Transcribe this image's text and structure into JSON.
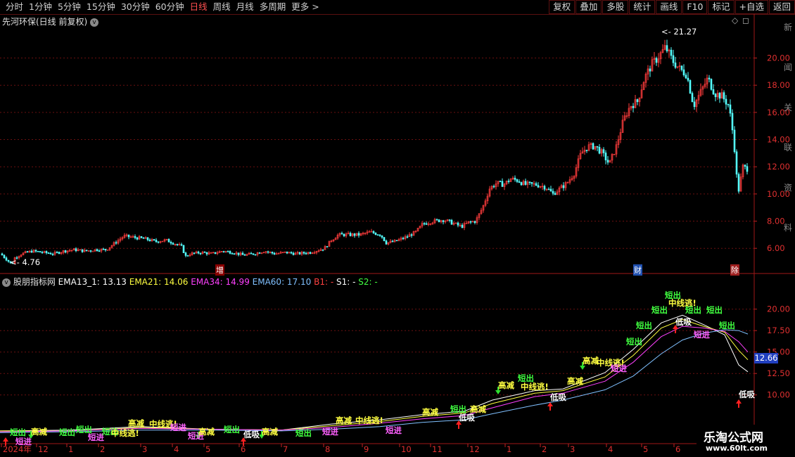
{
  "toolbar": {
    "periods": [
      "分时",
      "1分钟",
      "5分钟",
      "15分钟",
      "30分钟",
      "60分钟",
      "日线",
      "周线",
      "月线",
      "多周期",
      "更多"
    ],
    "active_period": "日线",
    "tools": [
      "复权",
      "叠加",
      "多股",
      "统计",
      "画线",
      "F10",
      "标记",
      "+自选",
      "返回"
    ]
  },
  "main_panel": {
    "title": "先河环保(日线 前复权)",
    "high_label": "21.27",
    "low_label": "4.76",
    "markers": [
      "增",
      "财",
      "除"
    ],
    "right_edge_labels": [
      "新",
      "闻",
      "关",
      "联",
      "资",
      "料"
    ]
  },
  "indicator_panel": {
    "name": "股朋指标网",
    "legend": [
      {
        "label": "EMA13_1: 13.13",
        "color": "#ffffff"
      },
      {
        "label": "EMA21: 14.06",
        "color": "#ffff40"
      },
      {
        "label": "EMA34: 14.99",
        "color": "#ff40ff"
      },
      {
        "label": "EMA60: 17.10",
        "color": "#80c0ff"
      },
      {
        "label": "B1: -",
        "color": "#ff4040"
      },
      {
        "label": "S1: -",
        "color": "#ffffff"
      },
      {
        "label": "S2: -",
        "color": "#40ff40"
      }
    ],
    "current_value": "12.66",
    "signal_words": {
      "short_out": "短出",
      "short_in": "短进",
      "high_reduce": "高减",
      "low_buy": "低吸",
      "mid_escape": "中线逃!"
    }
  },
  "chart_data": [
    {
      "type": "candlestick",
      "title": "先河环保(日线 前复权)",
      "y_ticks": [
        6.0,
        8.0,
        10.0,
        12.0,
        14.0,
        16.0,
        18.0,
        20.0
      ],
      "ylim": [
        4.2,
        22.2
      ],
      "annotations": [
        {
          "label": "21.27",
          "type": "max"
        },
        {
          "label": "4.76",
          "type": "min"
        }
      ],
      "x_ticks": [
        "2024年",
        "12",
        "1",
        "2",
        "3",
        "4",
        "5",
        "6",
        "7",
        "8",
        "9",
        "10",
        "11",
        "12",
        "1",
        "2",
        "3",
        "4",
        "5",
        "6"
      ],
      "close_path": [
        [
          0,
          5.6
        ],
        [
          6,
          5.3
        ],
        [
          12,
          5.0
        ],
        [
          16,
          4.8
        ],
        [
          20,
          5.3
        ],
        [
          30,
          5.6
        ],
        [
          45,
          5.8
        ],
        [
          60,
          5.7
        ],
        [
          75,
          5.6
        ],
        [
          90,
          5.8
        ],
        [
          105,
          5.9
        ],
        [
          120,
          5.8
        ],
        [
          135,
          5.9
        ],
        [
          150,
          5.9
        ],
        [
          165,
          6.5
        ],
        [
          175,
          6.9
        ],
        [
          190,
          6.8
        ],
        [
          205,
          6.7
        ],
        [
          220,
          6.5
        ],
        [
          235,
          6.6
        ],
        [
          250,
          6.3
        ],
        [
          258,
          6.1
        ],
        [
          262,
          5.4
        ],
        [
          270,
          5.6
        ],
        [
          285,
          5.7
        ],
        [
          300,
          5.6
        ],
        [
          315,
          5.8
        ],
        [
          330,
          5.7
        ],
        [
          345,
          5.5
        ],
        [
          360,
          5.6
        ],
        [
          375,
          5.8
        ],
        [
          390,
          5.6
        ],
        [
          405,
          5.7
        ],
        [
          420,
          5.6
        ],
        [
          440,
          5.7
        ],
        [
          460,
          6.0
        ],
        [
          470,
          6.6
        ],
        [
          480,
          7.0
        ],
        [
          495,
          7.0
        ],
        [
          510,
          7.0
        ],
        [
          525,
          7.2
        ],
        [
          540,
          7.0
        ],
        [
          548,
          6.4
        ],
        [
          560,
          6.5
        ],
        [
          575,
          6.8
        ],
        [
          590,
          7.2
        ],
        [
          600,
          7.8
        ],
        [
          615,
          8.0
        ],
        [
          630,
          8.1
        ],
        [
          645,
          7.8
        ],
        [
          655,
          7.6
        ],
        [
          665,
          7.9
        ],
        [
          675,
          8.0
        ],
        [
          685,
          9.0
        ],
        [
          695,
          10.4
        ],
        [
          705,
          10.8
        ],
        [
          715,
          10.7
        ],
        [
          725,
          11.1
        ],
        [
          735,
          11.0
        ],
        [
          745,
          10.7
        ],
        [
          760,
          10.7
        ],
        [
          775,
          10.5
        ],
        [
          785,
          10.0
        ],
        [
          795,
          10.4
        ],
        [
          805,
          10.8
        ],
        [
          815,
          11.5
        ],
        [
          825,
          13.0
        ],
        [
          835,
          13.5
        ],
        [
          845,
          13.5
        ],
        [
          855,
          13.0
        ],
        [
          865,
          12.2
        ],
        [
          875,
          13.5
        ],
        [
          885,
          15.4
        ],
        [
          895,
          16.5
        ],
        [
          905,
          16.8
        ],
        [
          915,
          18.5
        ],
        [
          925,
          19.5
        ],
        [
          935,
          20.1
        ],
        [
          945,
          20.8
        ],
        [
          955,
          19.8
        ],
        [
          965,
          19.2
        ],
        [
          975,
          18.8
        ],
        [
          985,
          16.5
        ],
        [
          995,
          17.5
        ],
        [
          1005,
          18.5
        ],
        [
          1015,
          17.4
        ],
        [
          1025,
          17.2
        ],
        [
          1035,
          16.5
        ],
        [
          1042,
          14.0
        ],
        [
          1048,
          10.0
        ],
        [
          1055,
          12.0
        ],
        [
          1063,
          11.8
        ]
      ]
    },
    {
      "type": "line",
      "title": "股朋指标网",
      "y_ticks": [
        10.0,
        12.5,
        15.0,
        17.5,
        20.0
      ],
      "ylim": [
        4.4,
        22.6
      ],
      "series": [
        {
          "name": "EMA13_1",
          "color": "#ffffff",
          "points": [
            [
              0,
              5.8
            ],
            [
              100,
              5.9
            ],
            [
              200,
              6.3
            ],
            [
              300,
              6.0
            ],
            [
              400,
              5.9
            ],
            [
              470,
              6.6
            ],
            [
              540,
              7.1
            ],
            [
              600,
              7.7
            ],
            [
              660,
              8.1
            ],
            [
              700,
              9.4
            ],
            [
              760,
              10.5
            ],
            [
              800,
              10.7
            ],
            [
              860,
              12.6
            ],
            [
              900,
              15.3
            ],
            [
              940,
              18.4
            ],
            [
              970,
              19.3
            ],
            [
              1000,
              18.2
            ],
            [
              1030,
              17.0
            ],
            [
              1050,
              13.5
            ],
            [
              1063,
              12.7
            ]
          ]
        },
        {
          "name": "EMA21",
          "color": "#ffff40",
          "points": [
            [
              0,
              5.8
            ],
            [
              100,
              5.8
            ],
            [
              200,
              6.2
            ],
            [
              300,
              6.0
            ],
            [
              400,
              5.9
            ],
            [
              470,
              6.4
            ],
            [
              540,
              6.9
            ],
            [
              600,
              7.5
            ],
            [
              660,
              7.9
            ],
            [
              700,
              9.0
            ],
            [
              760,
              10.2
            ],
            [
              800,
              10.5
            ],
            [
              860,
              12.1
            ],
            [
              900,
              14.6
            ],
            [
              940,
              17.8
            ],
            [
              970,
              18.8
            ],
            [
              1000,
              18.0
            ],
            [
              1030,
              17.3
            ],
            [
              1050,
              15.2
            ],
            [
              1063,
              14.1
            ]
          ]
        },
        {
          "name": "EMA34",
          "color": "#ff40ff",
          "points": [
            [
              0,
              5.7
            ],
            [
              100,
              5.8
            ],
            [
              200,
              6.1
            ],
            [
              300,
              6.0
            ],
            [
              400,
              5.9
            ],
            [
              470,
              6.2
            ],
            [
              540,
              6.7
            ],
            [
              600,
              7.2
            ],
            [
              660,
              7.6
            ],
            [
              700,
              8.5
            ],
            [
              760,
              9.8
            ],
            [
              800,
              10.2
            ],
            [
              860,
              11.6
            ],
            [
              900,
              13.8
            ],
            [
              940,
              16.8
            ],
            [
              970,
              18.0
            ],
            [
              1000,
              17.8
            ],
            [
              1030,
              17.4
            ],
            [
              1050,
              16.2
            ],
            [
              1063,
              15.0
            ]
          ]
        },
        {
          "name": "EMA60",
          "color": "#80c0ff",
          "points": [
            [
              0,
              5.6
            ],
            [
              100,
              5.7
            ],
            [
              200,
              5.9
            ],
            [
              300,
              5.9
            ],
            [
              400,
              5.8
            ],
            [
              470,
              6.0
            ],
            [
              540,
              6.3
            ],
            [
              600,
              6.8
            ],
            [
              660,
              7.1
            ],
            [
              700,
              7.8
            ],
            [
              760,
              8.8
            ],
            [
              800,
              9.4
            ],
            [
              860,
              10.6
            ],
            [
              900,
              12.2
            ],
            [
              940,
              14.8
            ],
            [
              970,
              16.4
            ],
            [
              1000,
              17.2
            ],
            [
              1030,
              17.6
            ],
            [
              1050,
              17.5
            ],
            [
              1063,
              17.1
            ]
          ]
        }
      ]
    }
  ]
}
